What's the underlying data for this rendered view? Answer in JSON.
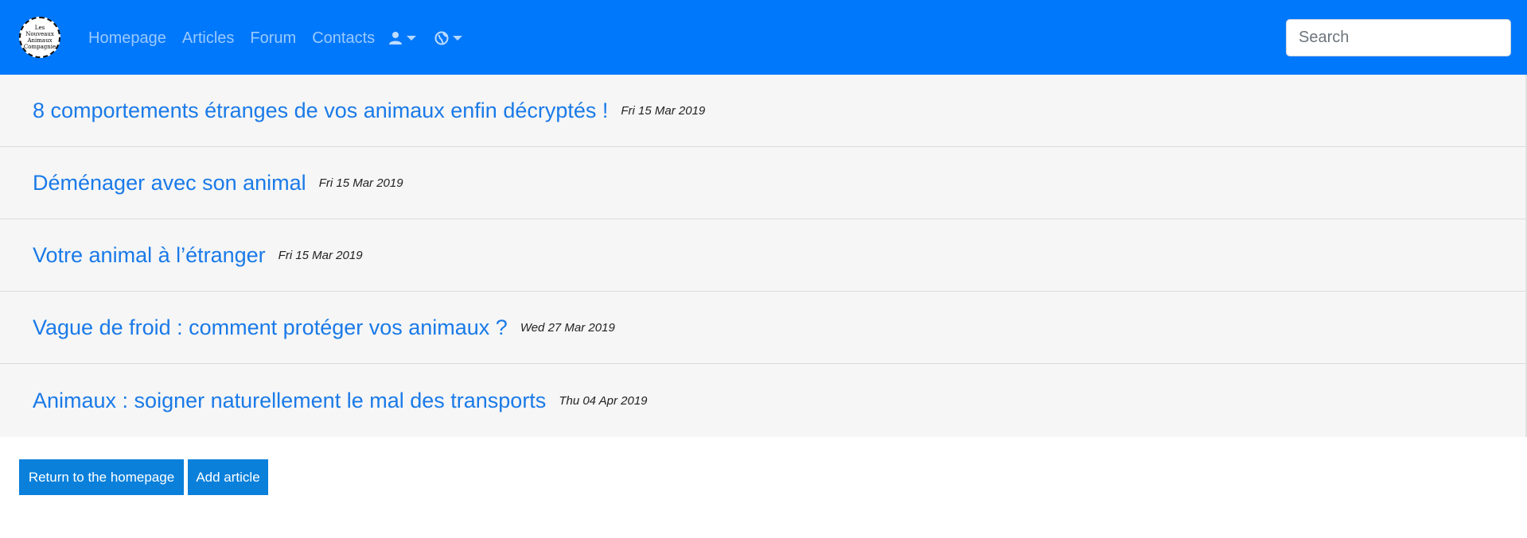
{
  "navbar": {
    "logo_text": [
      "Les",
      "Nouveaux",
      "Animaux",
      "Compagnie"
    ],
    "links": [
      "Homepage",
      "Articles",
      "Forum",
      "Contacts"
    ],
    "user_icon": "user-icon",
    "globe_icon": "globe-icon",
    "search_placeholder": "Search"
  },
  "articles": [
    {
      "title": "8 comportements étranges de vos animaux enfin décryptés !",
      "date": "Fri 15 Mar 2019"
    },
    {
      "title": "Déménager avec son animal",
      "date": "Fri 15 Mar 2019"
    },
    {
      "title": "Votre animal à l’étranger",
      "date": "Fri 15 Mar 2019"
    },
    {
      "title": "Vague de froid : comment protéger vos animaux ?",
      "date": "Wed 27 Mar 2019"
    },
    {
      "title": "Animaux : soigner naturellement le mal des transports",
      "date": "Thu 04 Apr 2019"
    }
  ],
  "actions": {
    "return_label": "Return to the homepage",
    "add_label": "Add article"
  },
  "colors": {
    "navbar": "#0078fc",
    "link": "#1a7ae8",
    "button": "#0a80db"
  }
}
